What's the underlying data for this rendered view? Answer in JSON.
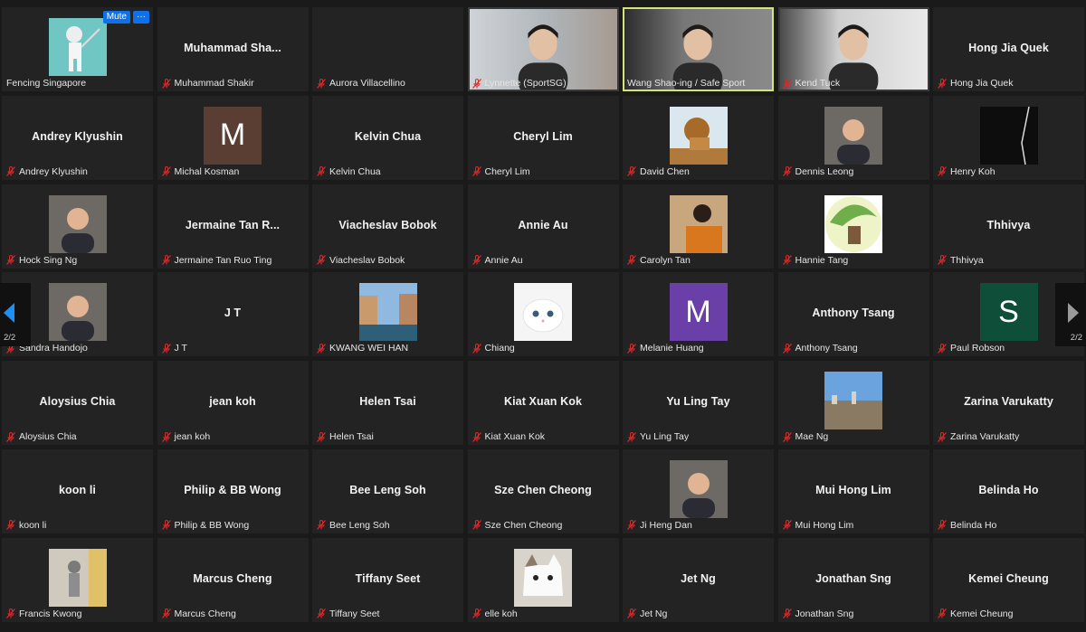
{
  "controls": {
    "mute_label": "Mute",
    "more_label": "···"
  },
  "pagination": {
    "left": "2/2",
    "right": "2/2"
  },
  "participants": [
    {
      "name": "Fencing Singapore",
      "big": "",
      "initial": "",
      "color": "",
      "picture": "fencer-avatar",
      "video": false,
      "muted": false
    },
    {
      "name": "Muhammad Shakir",
      "big": "Muhammad  Sha...",
      "initial": "",
      "color": "",
      "picture": "",
      "video": false,
      "muted": true
    },
    {
      "name": "Aurora Villacellino",
      "big": "",
      "initial": "",
      "color": "",
      "picture": "",
      "video": false,
      "muted": true
    },
    {
      "name": "Lynnette (SportSG)",
      "big": "",
      "initial": "",
      "color": "",
      "picture": "",
      "video": true,
      "muted": true
    },
    {
      "name": "Wang Shao-ing / Safe Sport",
      "big": "",
      "initial": "",
      "color": "",
      "picture": "",
      "video": true,
      "muted": false,
      "active": true
    },
    {
      "name": "Kend Tuck",
      "big": "",
      "initial": "",
      "color": "",
      "picture": "",
      "video": true,
      "muted": true
    },
    {
      "name": "Hong Jia Quek",
      "big": "Hong Jia Quek",
      "initial": "",
      "color": "",
      "picture": "",
      "video": false,
      "muted": true
    },
    {
      "name": "Andrey Klyushin",
      "big": "Andrey Klyushin",
      "initial": "",
      "color": "",
      "picture": "",
      "video": false,
      "muted": true
    },
    {
      "name": "Michal Kosman",
      "big": "",
      "initial": "M",
      "color": "#5a3d33",
      "picture": "",
      "video": false,
      "muted": true
    },
    {
      "name": "Kelvin Chua",
      "big": "Kelvin Chua",
      "initial": "",
      "color": "",
      "picture": "",
      "video": false,
      "muted": true
    },
    {
      "name": "Cheryl Lim",
      "big": "Cheryl Lim",
      "initial": "",
      "color": "",
      "picture": "",
      "video": false,
      "muted": true
    },
    {
      "name": "David Chen",
      "big": "",
      "initial": "",
      "color": "",
      "picture": "lion-photo",
      "video": false,
      "muted": true
    },
    {
      "name": "Dennis Leong",
      "big": "",
      "initial": "",
      "color": "",
      "picture": "portrait-photo",
      "video": false,
      "muted": true
    },
    {
      "name": "Henry Koh",
      "big": "",
      "initial": "",
      "color": "",
      "picture": "dark-photo",
      "video": false,
      "muted": true
    },
    {
      "name": "Hock Sing Ng",
      "big": "",
      "initial": "",
      "color": "",
      "picture": "portrait-photo",
      "video": false,
      "muted": true
    },
    {
      "name": "Jermaine Tan Ruo Ting",
      "big": "Jermaine Tan R...",
      "initial": "",
      "color": "",
      "picture": "",
      "video": false,
      "muted": true
    },
    {
      "name": "Viacheslav Bobok",
      "big": "Viacheslav Bobok",
      "initial": "",
      "color": "",
      "picture": "",
      "video": false,
      "muted": true
    },
    {
      "name": "Annie Au",
      "big": "Annie Au",
      "initial": "",
      "color": "",
      "picture": "",
      "video": false,
      "muted": true
    },
    {
      "name": "Carolyn Tan",
      "big": "",
      "initial": "",
      "color": "",
      "picture": "orange-photo",
      "video": false,
      "muted": true
    },
    {
      "name": "Hannie Tang",
      "big": "",
      "initial": "",
      "color": "",
      "picture": "illustration-photo",
      "video": false,
      "muted": true
    },
    {
      "name": "Thhivya",
      "big": "Thhivya",
      "initial": "",
      "color": "",
      "picture": "",
      "video": false,
      "muted": true
    },
    {
      "name": "Sandra Handojo",
      "big": "",
      "initial": "",
      "color": "",
      "picture": "portrait-photo",
      "video": false,
      "muted": true
    },
    {
      "name": "J T",
      "big": "J T",
      "initial": "",
      "color": "",
      "picture": "",
      "video": false,
      "muted": true
    },
    {
      "name": "KWANG WEI HAN",
      "big": "",
      "initial": "",
      "color": "",
      "picture": "canal-photo",
      "video": false,
      "muted": true
    },
    {
      "name": "Chiang",
      "big": "",
      "initial": "",
      "color": "",
      "picture": "white-cat-photo",
      "video": false,
      "muted": true
    },
    {
      "name": "Melanie Huang",
      "big": "",
      "initial": "M",
      "color": "#6a3fa8",
      "picture": "",
      "video": false,
      "muted": true
    },
    {
      "name": "Anthony Tsang",
      "big": "Anthony Tsang",
      "initial": "",
      "color": "",
      "picture": "",
      "video": false,
      "muted": true
    },
    {
      "name": "Paul Robson",
      "big": "",
      "initial": "S",
      "color": "#0f4f3a",
      "picture": "",
      "video": false,
      "muted": true
    },
    {
      "name": "Aloysius Chia",
      "big": "Aloysius Chia",
      "initial": "",
      "color": "",
      "picture": "",
      "video": false,
      "muted": true
    },
    {
      "name": "jean koh",
      "big": "jean koh",
      "initial": "",
      "color": "",
      "picture": "",
      "video": false,
      "muted": true
    },
    {
      "name": "Helen Tsai",
      "big": "Helen Tsai",
      "initial": "",
      "color": "",
      "picture": "",
      "video": false,
      "muted": true
    },
    {
      "name": "Kiat Xuan Kok",
      "big": "Kiat Xuan Kok",
      "initial": "",
      "color": "",
      "picture": "",
      "video": false,
      "muted": true
    },
    {
      "name": "Yu Ling Tay",
      "big": "Yu Ling Tay",
      "initial": "",
      "color": "",
      "picture": "",
      "video": false,
      "muted": true
    },
    {
      "name": "Mae Ng",
      "big": "",
      "initial": "",
      "color": "",
      "picture": "city-photo",
      "video": false,
      "muted": true
    },
    {
      "name": "Zarina Varukatty",
      "big": "Zarina Varukatty",
      "initial": "",
      "color": "",
      "picture": "",
      "video": false,
      "muted": true
    },
    {
      "name": "koon li",
      "big": "koon li",
      "initial": "",
      "color": "",
      "picture": "",
      "video": false,
      "muted": true
    },
    {
      "name": "Philip & BB Wong",
      "big": "Philip & BB Wong",
      "initial": "",
      "color": "",
      "picture": "",
      "video": false,
      "muted": true
    },
    {
      "name": "Bee Leng Soh",
      "big": "Bee Leng Soh",
      "initial": "",
      "color": "",
      "picture": "",
      "video": false,
      "muted": true
    },
    {
      "name": "Sze Chen Cheong",
      "big": "Sze Chen Cheong",
      "initial": "",
      "color": "",
      "picture": "",
      "video": false,
      "muted": true
    },
    {
      "name": "Ji Heng Dan",
      "big": "",
      "initial": "",
      "color": "",
      "picture": "portrait-photo",
      "video": false,
      "muted": true
    },
    {
      "name": "Mui Hong Lim",
      "big": "Mui Hong Lim",
      "initial": "",
      "color": "",
      "picture": "",
      "video": false,
      "muted": true
    },
    {
      "name": "Belinda Ho",
      "big": "Belinda Ho",
      "initial": "",
      "color": "",
      "picture": "",
      "video": false,
      "muted": true
    },
    {
      "name": "Francis Kwong",
      "big": "",
      "initial": "",
      "color": "",
      "picture": "street-photo",
      "video": false,
      "muted": true
    },
    {
      "name": "Marcus Cheng",
      "big": "Marcus Cheng",
      "initial": "",
      "color": "",
      "picture": "",
      "video": false,
      "muted": true
    },
    {
      "name": "Tiffany Seet",
      "big": "Tiffany Seet",
      "initial": "",
      "color": "",
      "picture": "",
      "video": false,
      "muted": true
    },
    {
      "name": "elle koh",
      "big": "",
      "initial": "",
      "color": "",
      "picture": "cat-photo",
      "video": false,
      "muted": true
    },
    {
      "name": "Jet Ng",
      "big": "Jet Ng",
      "initial": "",
      "color": "",
      "picture": "",
      "video": false,
      "muted": true
    },
    {
      "name": "Jonathan Sng",
      "big": "Jonathan Sng",
      "initial": "",
      "color": "",
      "picture": "",
      "video": false,
      "muted": true
    },
    {
      "name": "Kemei Cheung",
      "big": "Kemei Cheung",
      "initial": "",
      "color": "",
      "picture": "",
      "video": false,
      "muted": true
    }
  ]
}
